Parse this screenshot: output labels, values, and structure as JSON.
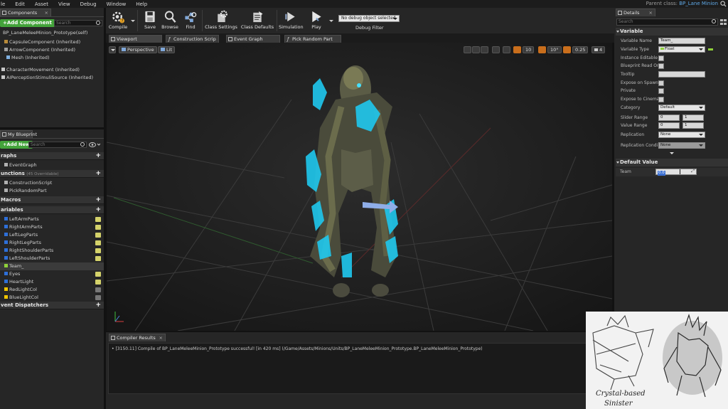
{
  "menu": [
    "le",
    "Edit",
    "Asset",
    "View",
    "Debug",
    "Window",
    "Help"
  ],
  "parent_class": {
    "label": "Parent class:",
    "value": "BP_Lane Minion"
  },
  "components": {
    "tab": "Components",
    "add_button": "+Add Component",
    "search_placeholder": "Search",
    "root": "BP_LaneMeleeMinion_Prototype(self)",
    "items": [
      "CapsuleComponent (Inherited)",
      "ArrowComponent (Inherited)",
      "Mesh (Inherited)",
      "CharacterMovement (Inherited)",
      "AIPerceptionStimuliSource (Inherited)"
    ]
  },
  "my_blueprint": {
    "tab": "My Blueprint",
    "add_button": "+Add New",
    "search_placeholder": "Search",
    "graphs_header": "raphs",
    "graphs": [
      "EventGraph"
    ],
    "functions_header": "unctions",
    "functions_note": "(45 Overridable)",
    "functions": [
      "ConstructionScript",
      "PickRandomPart"
    ],
    "macros_header": "Macros",
    "variables_header": "ariables",
    "variables": [
      {
        "name": "LeftArmParts",
        "color": "#2e6fd8",
        "eye": "on"
      },
      {
        "name": "RightArmParts",
        "color": "#2e6fd8",
        "eye": "on"
      },
      {
        "name": "LeftLegParts",
        "color": "#2e6fd8",
        "eye": "on"
      },
      {
        "name": "RightLegParts",
        "color": "#2e6fd8",
        "eye": "on"
      },
      {
        "name": "RightShoulderParts",
        "color": "#2e6fd8",
        "eye": "on"
      },
      {
        "name": "LeftShoulderParts",
        "color": "#2e6fd8",
        "eye": "on"
      },
      {
        "name": "Team_",
        "color": "#8fd13a",
        "eye": "sel"
      },
      {
        "name": "Eyes",
        "color": "#2e6fd8",
        "eye": "on"
      },
      {
        "name": "HeartLight",
        "color": "#2e6fd8",
        "eye": "on"
      },
      {
        "name": "RedLightCol",
        "color": "#f0c500",
        "eye": "off"
      },
      {
        "name": "BlueLightCol",
        "color": "#f0c500",
        "eye": "off"
      }
    ],
    "dispatchers_header": "vent Dispatchers"
  },
  "toolbar": {
    "buttons": [
      "Compile",
      "Save",
      "Browse",
      "Find",
      "Class Settings",
      "Class Defaults",
      "Simulation",
      "Play"
    ],
    "debug_select": "No debug object selected",
    "debug_filter": "Debug Filter"
  },
  "doc_tabs": [
    "Viewport",
    "Construction Scrip",
    "Event Graph",
    "Pick Random Part"
  ],
  "viewport": {
    "perspective": "Perspective",
    "lit": "Lit",
    "grid_snap": "10",
    "rot_snap": "10°",
    "scale_snap": "0.25",
    "cam_speed": "4"
  },
  "compiler": {
    "tab": "Compiler Results",
    "message": "[3150.11] Compile of BP_LaneMeleeMinion_Prototype successful! [in 420 ms] (/Game/Assets/Minions/Units/BP_LaneMeleeMinion_Prototype.BP_LaneMeleeMinion_Prototype)"
  },
  "details": {
    "tab": "Details",
    "search_placeholder": "Search",
    "variable_header": "Variable",
    "rows": [
      {
        "label": "Variable Name",
        "kind": "text",
        "value": "Team_"
      },
      {
        "label": "Variable Type",
        "kind": "type",
        "value": "Float"
      },
      {
        "label": "Instance Editable",
        "kind": "check"
      },
      {
        "label": "Blueprint Read Or",
        "kind": "check"
      },
      {
        "label": "Tooltip",
        "kind": "text",
        "value": ""
      },
      {
        "label": "Expose on Spawn",
        "kind": "check"
      },
      {
        "label": "Private",
        "kind": "check"
      },
      {
        "label": "Expose to Cinema",
        "kind": "check"
      },
      {
        "label": "Category",
        "kind": "drop",
        "value": "Default"
      },
      {
        "label": "Slider Range",
        "kind": "range",
        "a": "0",
        "b": "1"
      },
      {
        "label": "Value Range",
        "kind": "range",
        "a": "0",
        "b": "1"
      },
      {
        "label": "Replication",
        "kind": "drop",
        "value": "None"
      },
      {
        "label": "Replication Condi",
        "kind": "drop",
        "value": "None"
      }
    ],
    "default_header": "Default Value",
    "team_label": "Team",
    "team_value": "0.0"
  },
  "sketch": {
    "caption1": "Crystal-based",
    "caption2": "Sinister"
  }
}
